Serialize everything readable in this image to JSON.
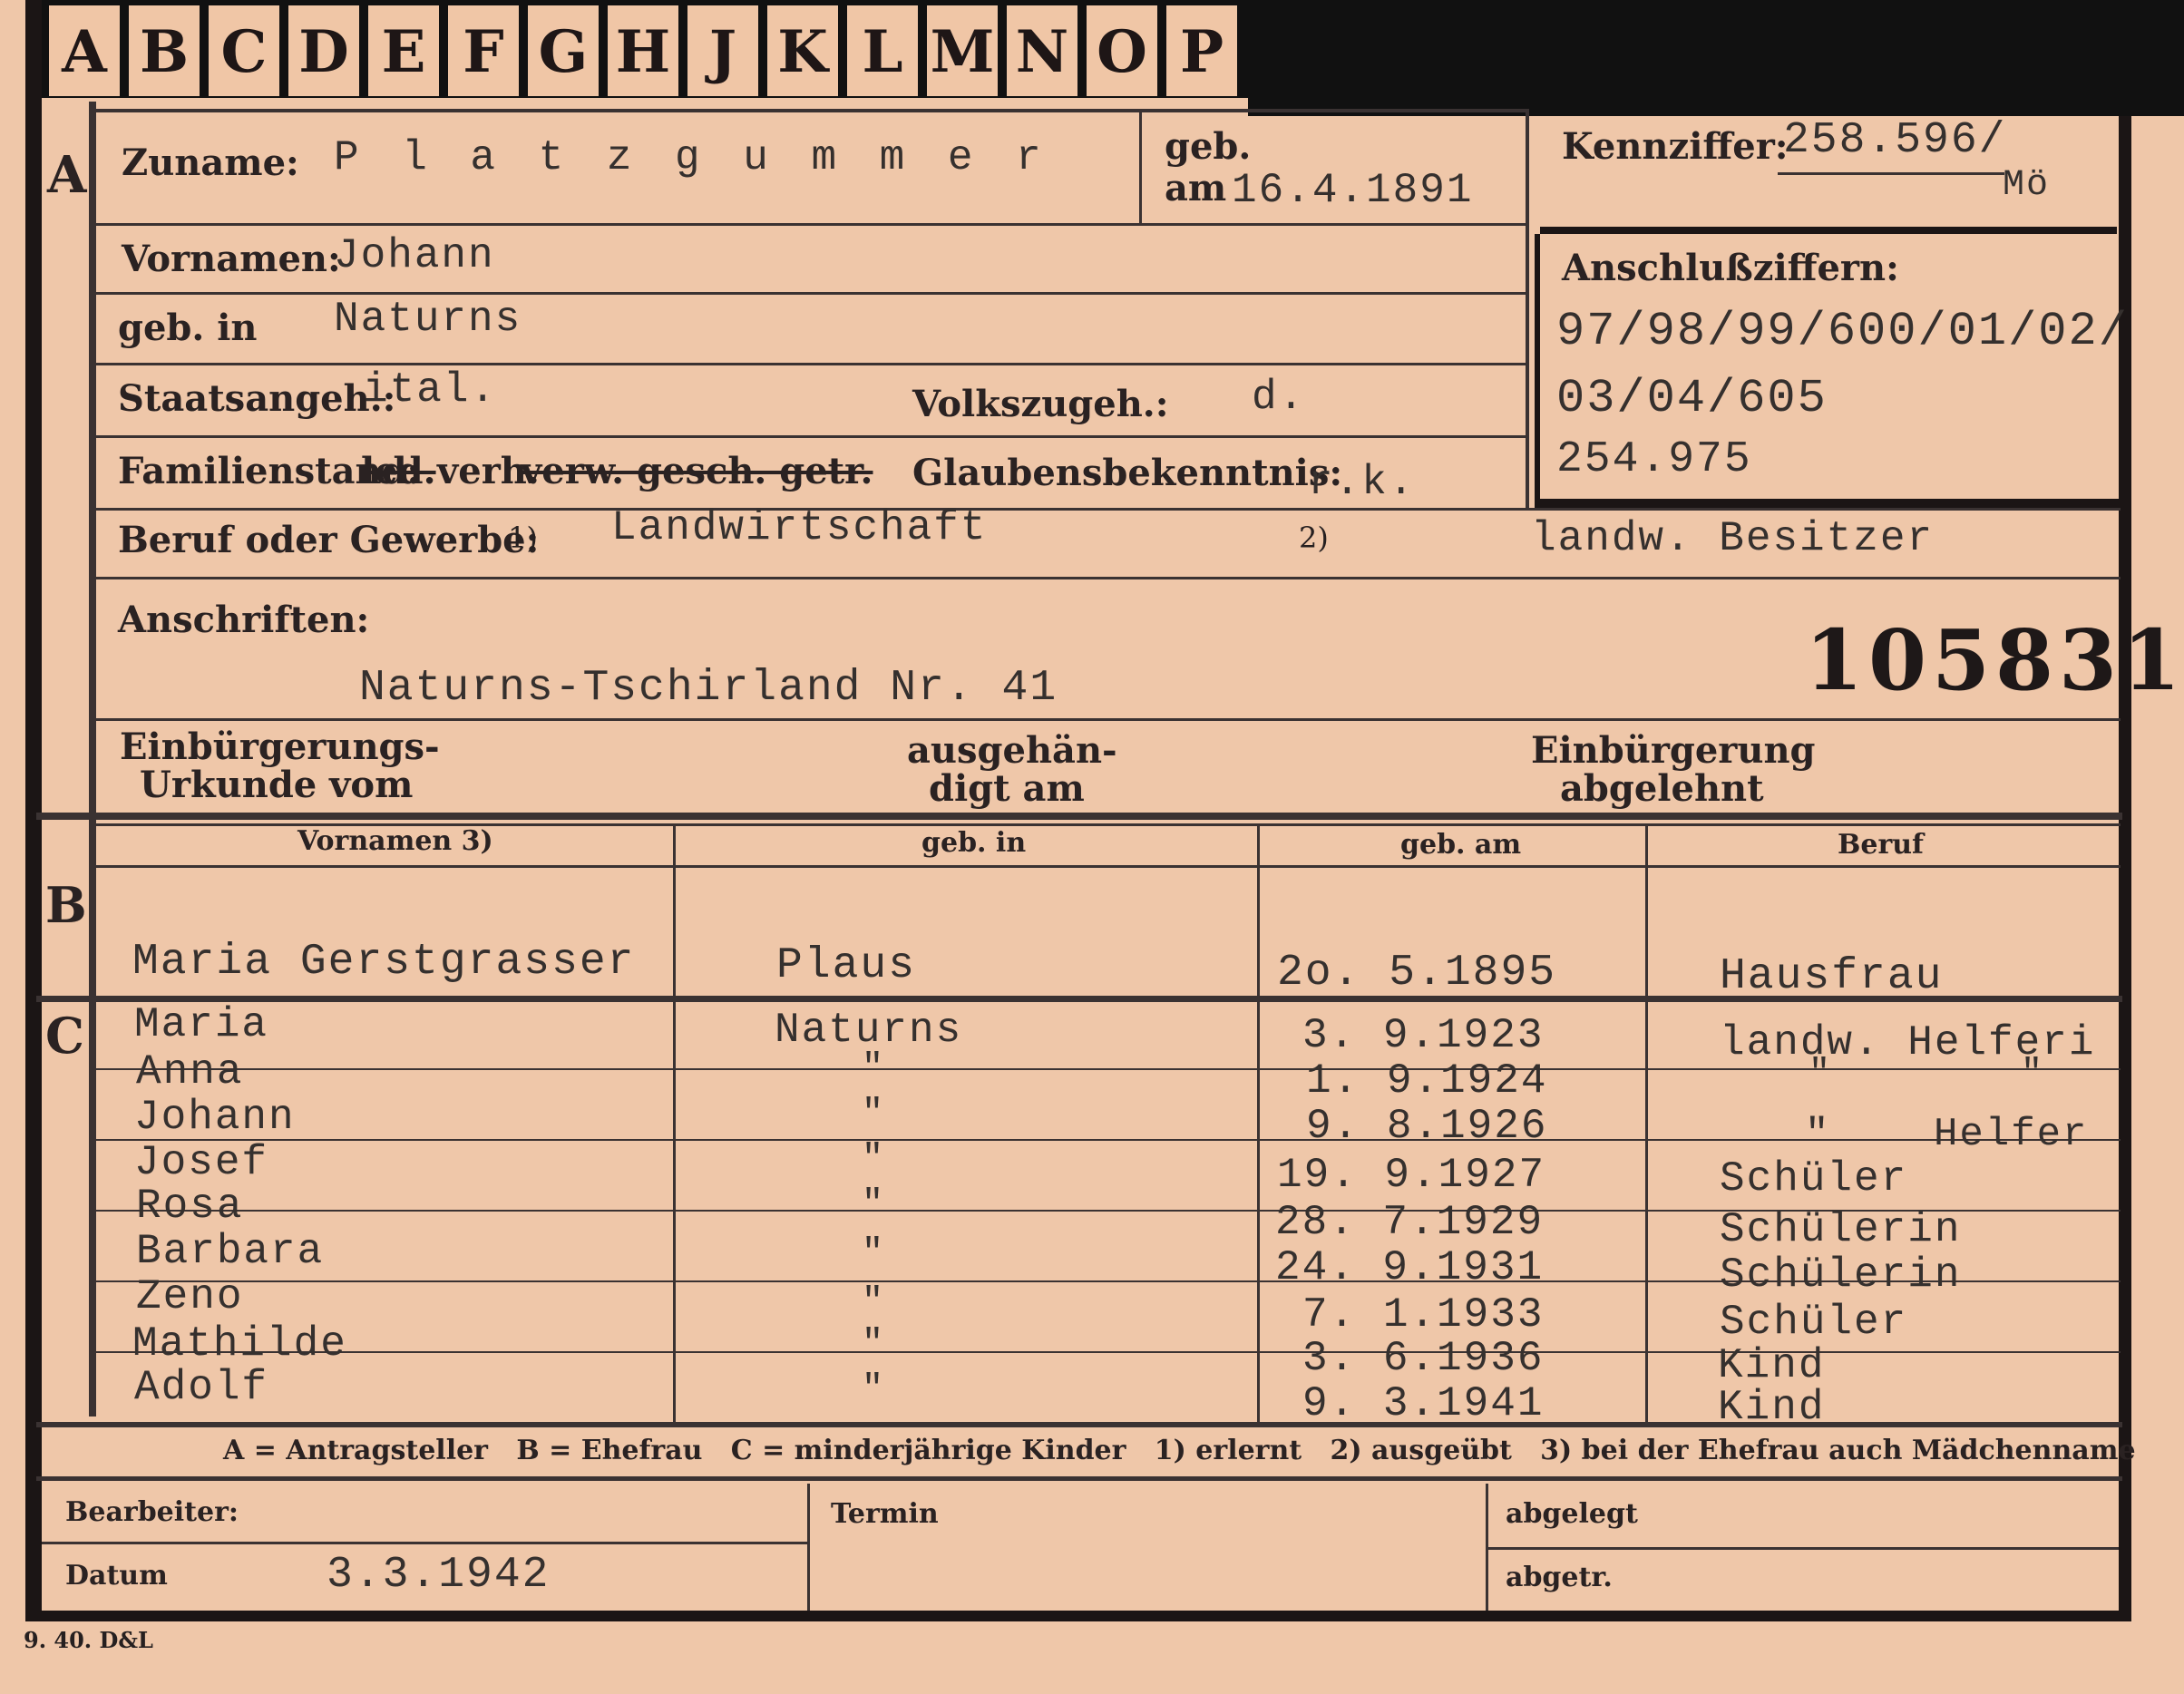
{
  "index_tabs": [
    "A",
    "B",
    "C",
    "D",
    "E",
    "F",
    "G",
    "H",
    "J",
    "K",
    "L",
    "M",
    "N",
    "O",
    "P"
  ],
  "section_markers": {
    "a": "A",
    "b": "B",
    "c": "C"
  },
  "applicant": {
    "surname_label": "Zuname:",
    "surname": "P l a t z g u m m e r",
    "born_label_1": "geb.",
    "born_label_2": "am",
    "born_date": "16.4.1891",
    "reference_label": "Kennziffer:",
    "reference_number": "258.596/",
    "reference_suffix": "Mö",
    "first_names_label": "Vornamen:",
    "first_names": "Johann",
    "birthplace_label": "geb. in",
    "birthplace": "Naturns",
    "citizenship_label": "Staatsangeh.:",
    "citizenship": "ital.",
    "ethnicity_label": "Volkszugeh.:",
    "ethnicity": "d.",
    "marital_label": "Familienstand:",
    "marital_opt_single": "led.",
    "marital_opt_married": "verh.",
    "marital_opt_struck": "verw. gesch. getr.",
    "religion_label": "Glaubensbekenntnis:",
    "religion": "r.k.",
    "linked_label": "Anschlußziffern:",
    "linked_lines": [
      "97/98/99/600/01/02/",
      "03/04/605",
      "254.975"
    ],
    "occupation_label": "Beruf oder Gewerbe:",
    "occ_marker_1": "1)",
    "occupation_learned": "Landwirtschaft",
    "occ_marker_2": "2)",
    "occupation_practiced": "landw. Besitzer",
    "address_label": "Anschriften:",
    "address": "Naturns-Tschirland Nr. 41",
    "stamp_number": "105831",
    "naturalization_doc_label_1": "Einbürgerungs-",
    "naturalization_doc_label_2": "Urkunde vom",
    "handed_label_1": "ausgehän-",
    "handed_label_2": "digt am",
    "rejected_label_1": "Einbürgerung",
    "rejected_label_2": "abgelehnt"
  },
  "family_table": {
    "headers": {
      "first_names": "Vornamen 3)",
      "birthplace": "geb. in",
      "born": "geb. am",
      "occupation": "Beruf"
    },
    "wife": {
      "name": "Maria Gerstgrasser",
      "birthplace": "Plaus",
      "born": "2o. 5.1895",
      "occupation": "Hausfrau"
    },
    "children": [
      {
        "name": "Maria",
        "birthplace": "Naturns",
        "born": "3. 9.1923",
        "occupation": "landw. Helferi"
      },
      {
        "name": "Anna",
        "birthplace": "\"",
        "born": "1. 9.1924",
        "occupation": "\"        \""
      },
      {
        "name": "Johann",
        "birthplace": "\"",
        "born": "9. 8.1926",
        "occupation": "\"    Helfer"
      },
      {
        "name": "Josef",
        "birthplace": "\"",
        "born": "19. 9.1927",
        "occupation": "Schüler"
      },
      {
        "name": "Rosa",
        "birthplace": "\"",
        "born": "28. 7.1929",
        "occupation": "Schülerin"
      },
      {
        "name": "Barbara",
        "birthplace": "\"",
        "born": "24. 9.1931",
        "occupation": "Schülerin"
      },
      {
        "name": "Zeno",
        "birthplace": "\"",
        "born": "7. 1.1933",
        "occupation": "Schüler"
      },
      {
        "name": "Mathilde",
        "birthplace": "\"",
        "born": "3. 6.1936",
        "occupation": "Kind"
      },
      {
        "name": "Adolf",
        "birthplace": "\"",
        "born": "9. 3.1941",
        "occupation": "Kind"
      }
    ]
  },
  "legend": "A = Antragsteller   B = Ehefrau   C = minderjährige Kinder   1) erlernt   2) ausgeübt   3) bei der Ehefrau auch Mädchenname",
  "footer": {
    "clerk_label": "Bearbeiter:",
    "date_label": "Datum",
    "date_value": "3.3.1942",
    "appointment_label": "Termin",
    "filed_label": "abgelegt",
    "separated_label": "abgetr."
  },
  "print_code": "9. 40. D&L",
  "colors": {
    "card": "#efc7a9",
    "ink": "#2a2222",
    "typewriter": "#35302e",
    "background": "#111111"
  }
}
